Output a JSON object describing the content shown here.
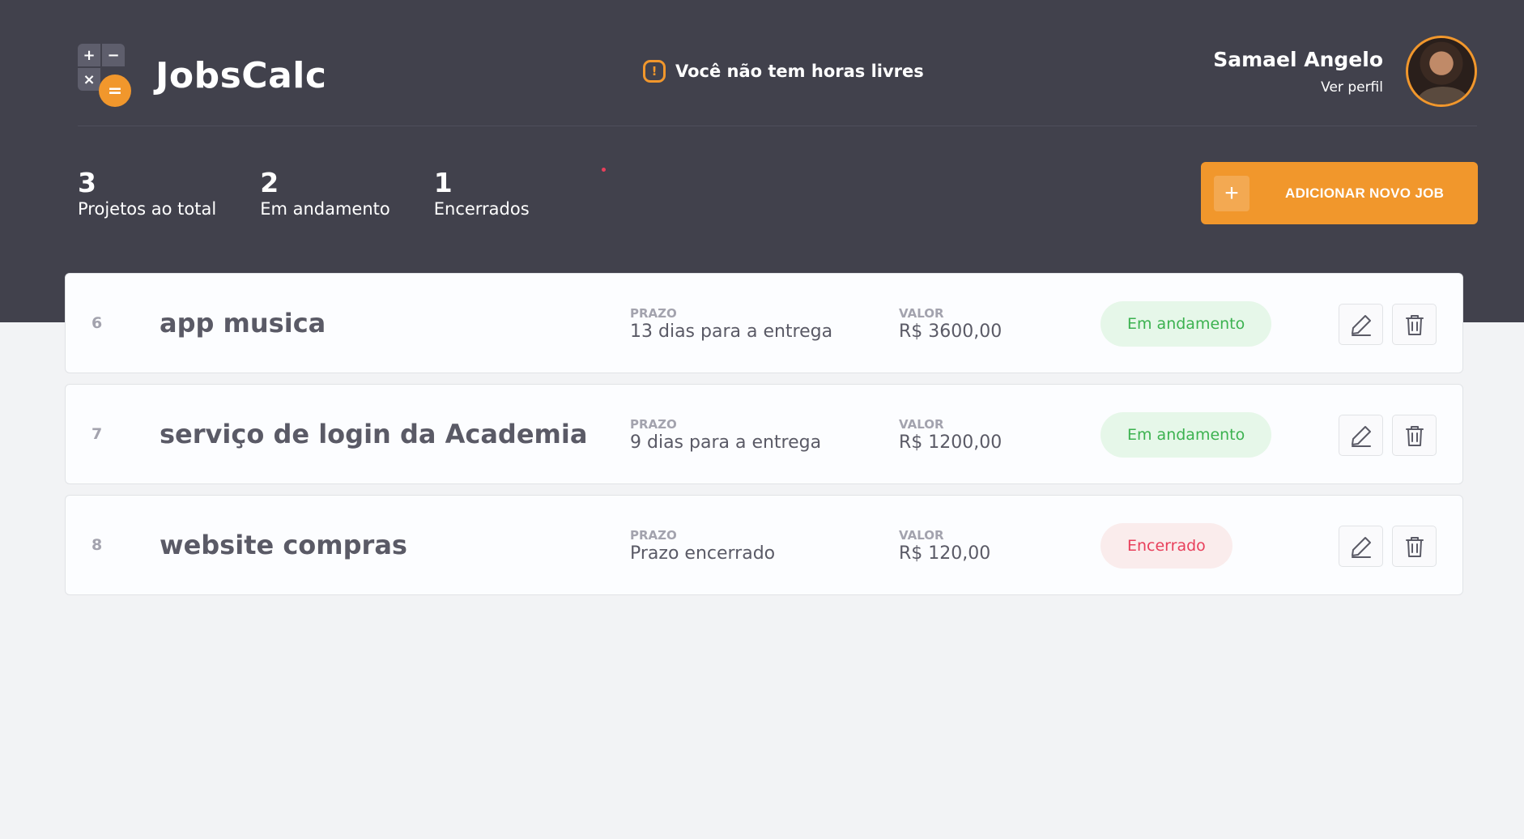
{
  "app": {
    "name": "JobsCalc",
    "logo_symbols": [
      "+",
      "−",
      "×",
      "="
    ]
  },
  "alert": {
    "icon": "alert-icon",
    "text": "Você não tem horas livres"
  },
  "profile": {
    "name": "Samael Angelo",
    "link_label": "Ver perfil"
  },
  "stats": [
    {
      "value": "3",
      "label": "Projetos ao total"
    },
    {
      "value": "2",
      "label": "Em andamento"
    },
    {
      "value": "1",
      "label": "Encerrados"
    }
  ],
  "add_button": {
    "icon": "plus-icon",
    "label": "ADICIONAR NOVO JOB"
  },
  "jobs": [
    {
      "id": "6",
      "name": "app musica",
      "deadline_caption": "PRAZO",
      "deadline": "13 dias para a entrega",
      "value_caption": "VALOR",
      "value": "R$ 3600,00",
      "status": "Em andamento",
      "status_type": "progress"
    },
    {
      "id": "7",
      "name": "serviço de login da Academia",
      "deadline_caption": "PRAZO",
      "deadline": "9 dias para a entrega",
      "value_caption": "VALOR",
      "value": "R$ 1200,00",
      "status": "Em andamento",
      "status_type": "progress"
    },
    {
      "id": "8",
      "name": "website compras",
      "deadline_caption": "PRAZO",
      "deadline": "Prazo encerrado",
      "value_caption": "VALOR",
      "value": "R$ 120,00",
      "status": "Encerrado",
      "status_type": "closed"
    }
  ],
  "colors": {
    "header_bg": "#41414C",
    "page_bg": "#F2F3F5",
    "accent": "#F1972C",
    "status_progress_text": "#3CB250",
    "status_progress_bg": "#E6F7E9",
    "status_closed_text": "#E83F5B",
    "status_closed_bg": "#FAECEC"
  }
}
